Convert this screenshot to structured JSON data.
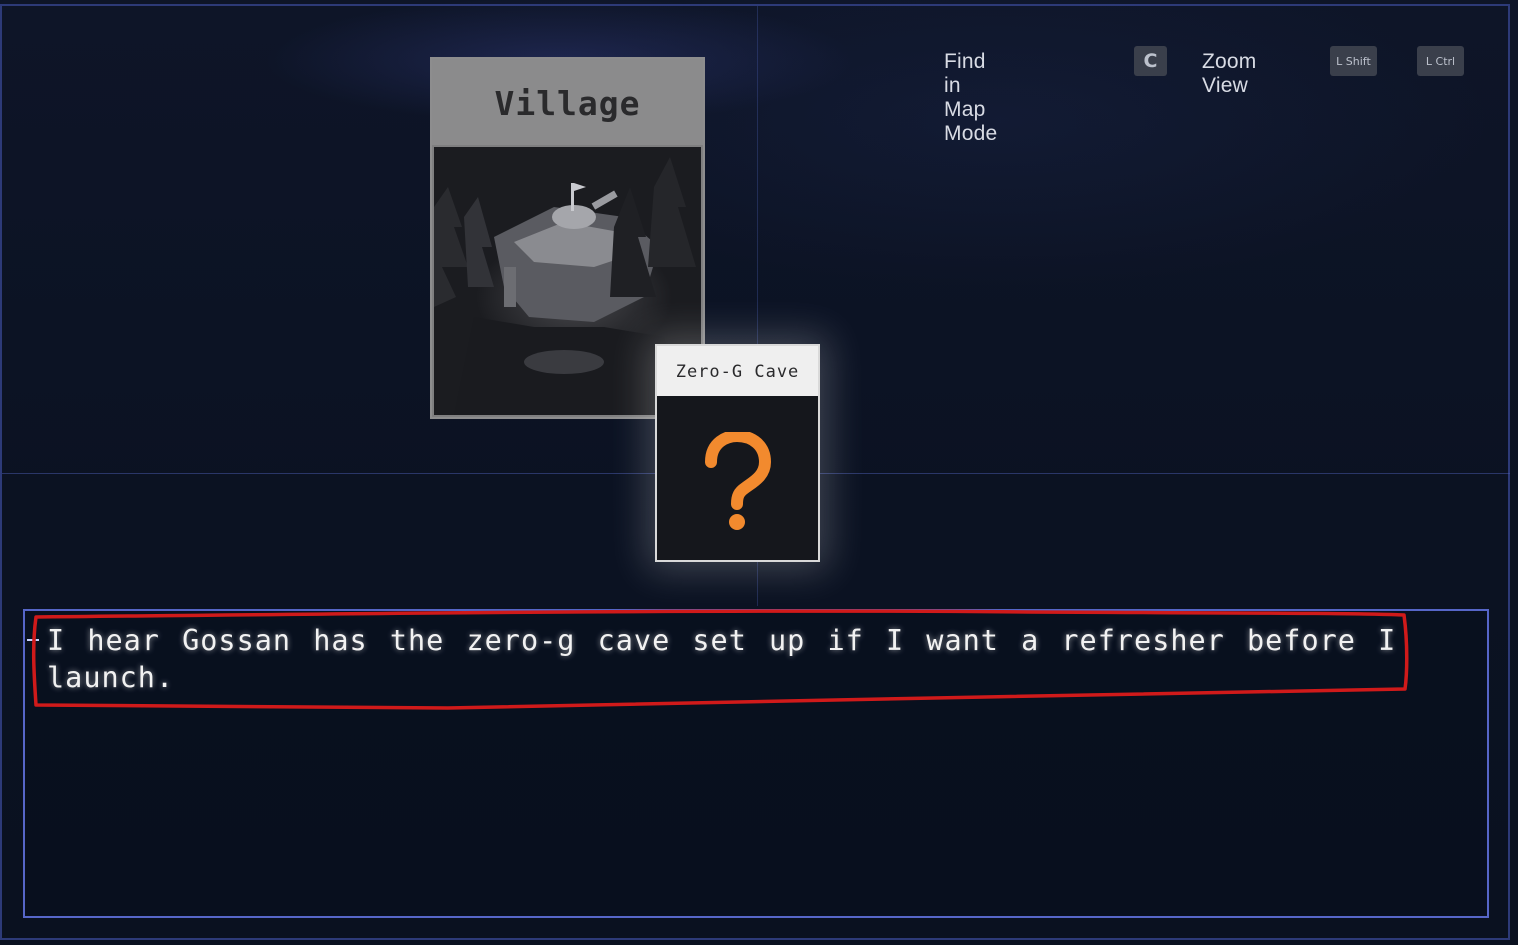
{
  "hints": {
    "find_label": "Find in Map Mode",
    "find_key": "C",
    "zoom_label": "Zoom View",
    "zoom_key": "L Shift",
    "extra_key": "L Ctrl"
  },
  "cards": {
    "village": {
      "title": "Village"
    },
    "cave": {
      "title": "Zero-G Cave",
      "icon": "question-mark-icon",
      "icon_color": "#f28a2e"
    }
  },
  "dialogue": {
    "text": "I hear Gossan has the zero-g cave set up if I want a refresher before I launch."
  },
  "colors": {
    "frame": "#2d3a78",
    "dialogue_border": "#5666c8",
    "annotation": "#d01a1a"
  }
}
